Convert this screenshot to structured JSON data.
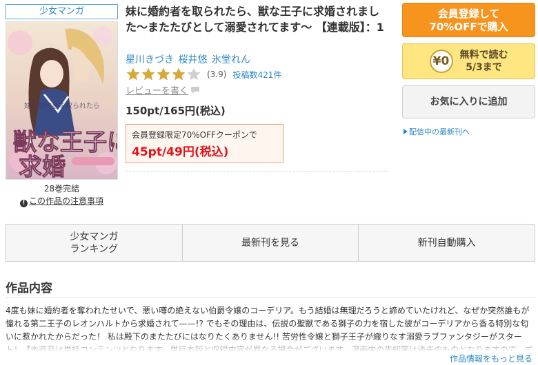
{
  "book": {
    "genre": "少女マンガ",
    "title": "妹に婚約者を取られたら、獣な王子に求婚されました〜またたびとして溺愛されてます〜 【連載版】：1",
    "authors": "星川きづき 桜井悠 氷堂れん",
    "rating_value": 3.9,
    "rating_text": "(3.9)",
    "review_count": "投稿数421件",
    "review_link": "レビューを書く",
    "price": "150pt/165円(税込)",
    "coupon_label": "会員登録限定70%OFFクーポンで",
    "coupon_price": "45pt/49円(税込)",
    "volume_status": "28巻完結",
    "notice": "この作品の注意事項",
    "cover_icon": "book-cover-image"
  },
  "actions": {
    "register_line1": "会員登録して",
    "register_line2": "70%OFFで購入",
    "coin_label": "¥0",
    "free_line1": "無料で読む",
    "free_line2": "5/3まで",
    "favorite": "お気に入りに追加",
    "latest_link": "配信中の最新刊へ"
  },
  "tabs": [
    {
      "label": "少女マンガ\nランキング"
    },
    {
      "label": "最新刊を見る"
    },
    {
      "label": "新刊自動購入"
    }
  ],
  "section": {
    "title": "作品内容",
    "description": "4度も妹に婚約者を奪われたせいで、悪い噂の絶えない伯爵令嬢のコーデリア。もう結婚は無理だろうと諦めていたけれど、なぜか突然誰もが憧れる第二王子のレオンハルトから求婚されて——!? でもその理由は、伝説の聖獣である獅子の力を宿した彼がコーデリアから香る特別な匂いに惹かれたからだった！ 私は殿下のまたたびにはなりたくありません!! 苦労性令嬢と獅子王子が織りなす溺愛ラブファンタジーがスタート！【本商品は単話コンテンツとなります。単行本版と収録内容が異なる場合がございます。漫画内の告知等は過去のものとなりますので、ご",
    "more_link": "作品情報をもっと見る"
  },
  "colors": {
    "accent_blue": "#2b86c5",
    "register_orange": "#f7941e",
    "free_yellow": "#ffe680",
    "sale_red": "#e4121c",
    "star_gold": "#d6a93a"
  }
}
